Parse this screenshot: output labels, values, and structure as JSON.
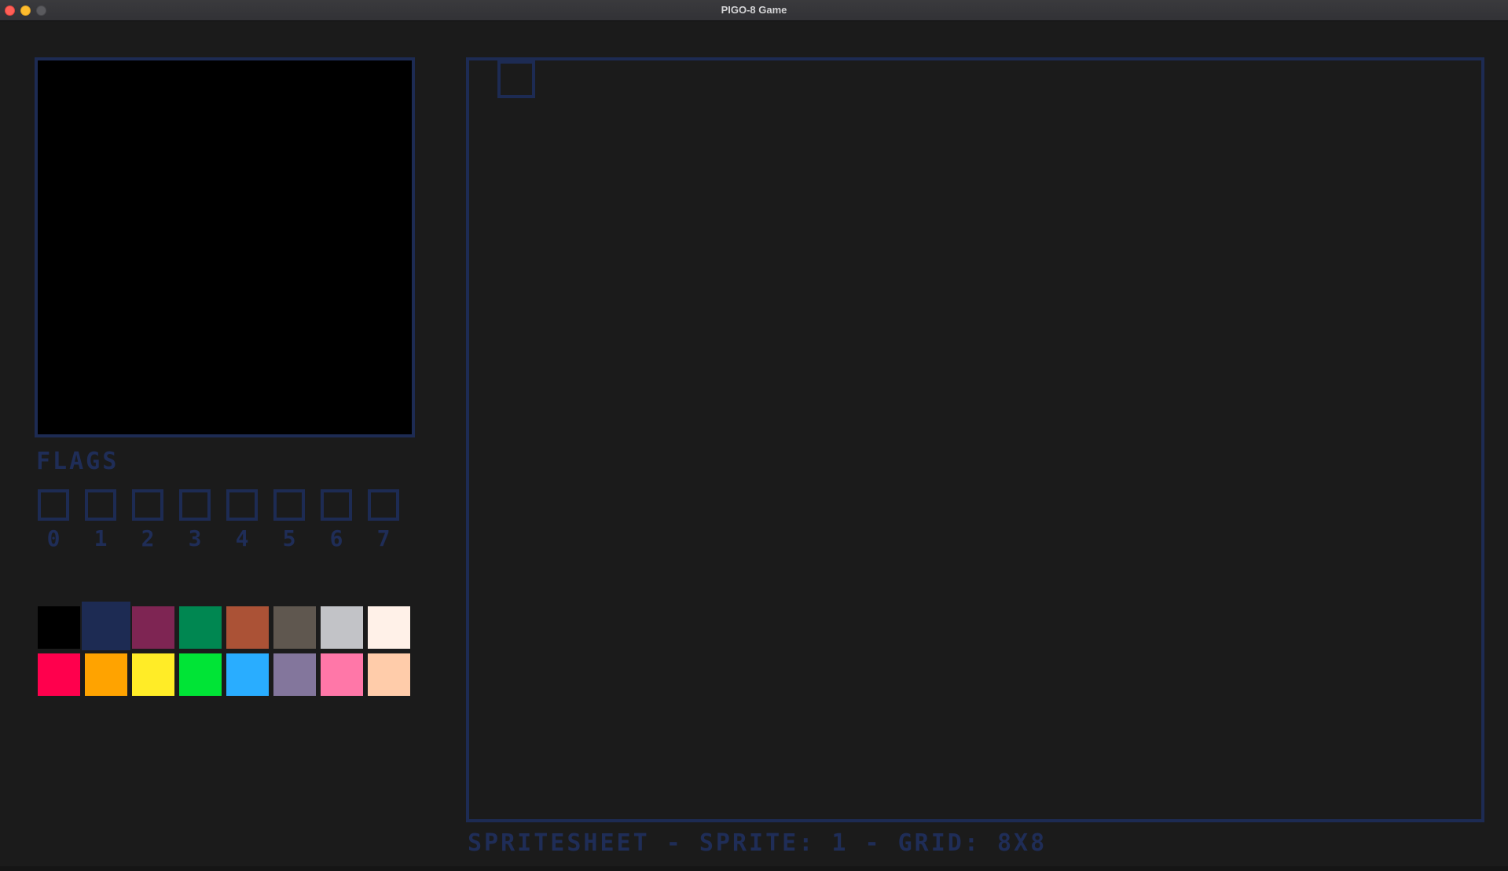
{
  "window": {
    "title": "PIGO-8 Game"
  },
  "editor": {
    "flags_label": "FLAGS",
    "flags": [
      "0",
      "1",
      "2",
      "3",
      "4",
      "5",
      "6",
      "7"
    ],
    "palette": [
      "#000000",
      "#1d2b53",
      "#7e2553",
      "#008751",
      "#ab5236",
      "#5f574f",
      "#c2c3c7",
      "#fff1e8",
      "#ff004d",
      "#ffa300",
      "#ffec27",
      "#00e436",
      "#29adff",
      "#83769c",
      "#ff77a8",
      "#ffccaa"
    ],
    "selected_color_index": 1
  },
  "spritesheet": {
    "status": "SPRITESHEET - SPRITE: 1 - GRID: 8X8"
  }
}
